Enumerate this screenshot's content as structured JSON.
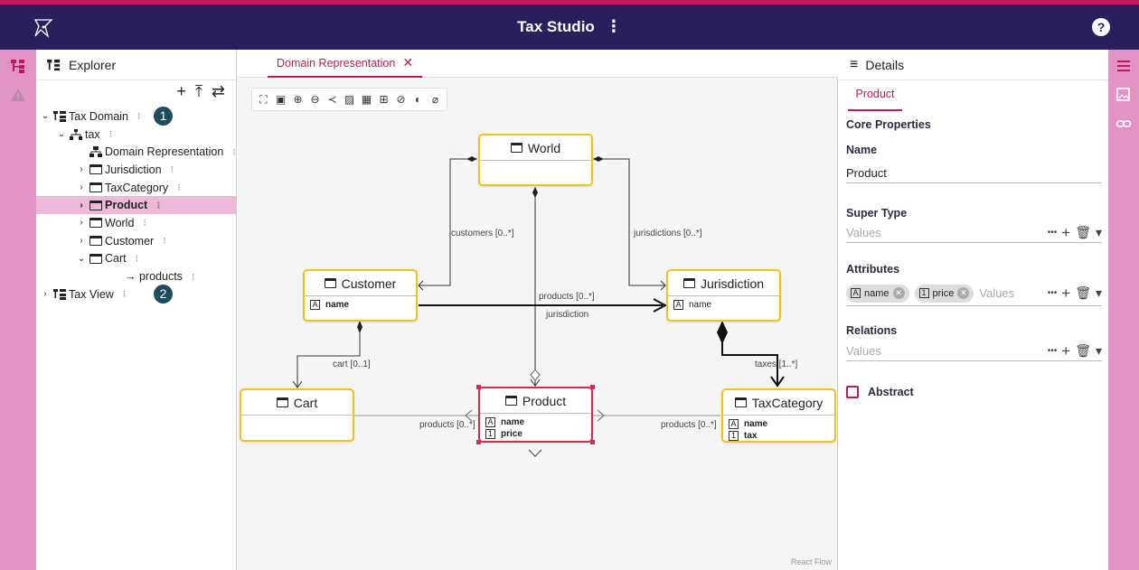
{
  "app": {
    "title": "Tax Studio",
    "menu_glyph": "⋮",
    "help_glyph": "?"
  },
  "explorer": {
    "title": "Explorer",
    "tools": [
      "+",
      "⤒",
      "⇄"
    ],
    "tree": [
      {
        "label": "Tax Domain",
        "icon": "package-icon",
        "chev": "⌄",
        "indent": 0,
        "badge": "1"
      },
      {
        "label": "tax",
        "icon": "hierarchy-icon",
        "chev": "⌄",
        "indent": 1
      },
      {
        "label": "Domain Representation",
        "icon": "diagram-icon",
        "chev": "",
        "indent": 2
      },
      {
        "label": "Jurisdiction",
        "icon": "class-icon",
        "chev": "›",
        "indent": 2
      },
      {
        "label": "TaxCategory",
        "icon": "class-icon",
        "chev": "›",
        "indent": 2
      },
      {
        "label": "Product",
        "icon": "class-icon",
        "chev": "›",
        "indent": 2,
        "selected": true
      },
      {
        "label": "World",
        "icon": "class-icon",
        "chev": "›",
        "indent": 2
      },
      {
        "label": "Customer",
        "icon": "class-icon",
        "chev": "›",
        "indent": 2
      },
      {
        "label": "Cart",
        "icon": "class-icon",
        "chev": "⌄",
        "indent": 2
      },
      {
        "label": "→ products",
        "icon": "",
        "chev": "",
        "indent": 3
      },
      {
        "label": "Tax View",
        "icon": "package-icon",
        "chev": "›",
        "indent": 0,
        "badge": "2"
      }
    ]
  },
  "editor": {
    "tab_label": "Domain Representation",
    "watermark": "React Flow",
    "nodes": {
      "world": {
        "name": "World"
      },
      "customer": {
        "name": "Customer",
        "attrs": [
          {
            "icon": "A",
            "name": "name",
            "bold": true
          }
        ]
      },
      "jurisdiction": {
        "name": "Jurisdiction",
        "attrs": [
          {
            "icon": "A",
            "name": "name",
            "bold": false
          }
        ]
      },
      "cart": {
        "name": "Cart"
      },
      "product": {
        "name": "Product",
        "attrs": [
          {
            "icon": "A",
            "name": "name",
            "bold": true
          },
          {
            "icon": "1",
            "name": "price",
            "bold": true
          }
        ]
      },
      "taxcategory": {
        "name": "TaxCategory",
        "attrs": [
          {
            "icon": "A",
            "name": "name",
            "bold": true
          },
          {
            "icon": "1",
            "name": "tax",
            "bold": true
          }
        ]
      }
    },
    "edge_labels": {
      "customers": "customers [0..*]",
      "jurisdictions": "jurisdictions [0..*]",
      "products_top": "products [0..*]",
      "jurisdiction": "jurisdiction",
      "cart": "cart [0..1]",
      "taxes": "taxes [1..*]",
      "products_cart": "products [0..*]",
      "products_tax": "products [0..*]"
    }
  },
  "details": {
    "title": "Details",
    "tab": "Product",
    "core_properties": "Core Properties",
    "name_label": "Name",
    "name_value": "Product",
    "super_type_label": "Super Type",
    "values_placeholder": "Values",
    "attributes_label": "Attributes",
    "attribute_chips": [
      {
        "icon": "A",
        "label": "name"
      },
      {
        "icon": "1",
        "label": "price"
      }
    ],
    "relations_label": "Relations",
    "abstract_label": "Abstract",
    "action_glyphs": {
      "more": "•••",
      "add": "+",
      "delete": "🗑",
      "dropdown": "▾"
    }
  },
  "colors": {
    "brand": "#2a1f5c",
    "accent": "#c2185b",
    "rail": "#e294c4",
    "node_border": "#f0c21f",
    "selected_border": "#d22c4b"
  }
}
